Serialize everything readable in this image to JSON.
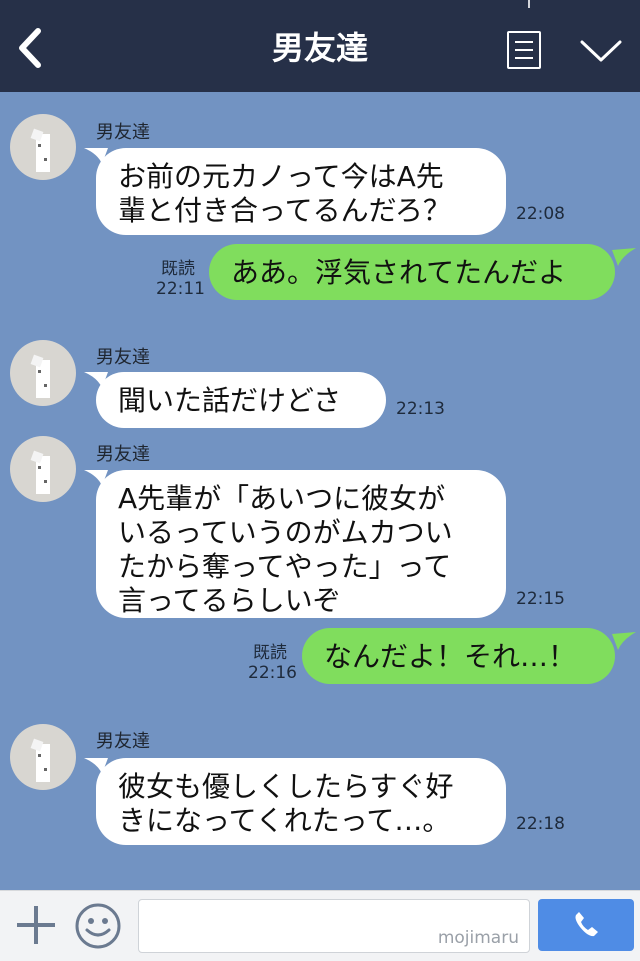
{
  "header": {
    "title": "男友達"
  },
  "messages": [
    {
      "sender": "男友達",
      "text": "お前の元カノって今はA先\n輩と付き合ってるんだろ？",
      "time": "22:08"
    },
    {
      "sender": "me",
      "read": "既読",
      "time": "22:11",
      "text": "ああ。浮気されてたんだよ"
    },
    {
      "sender": "男友達",
      "text": "聞いた話だけどさ",
      "time": "22:13"
    },
    {
      "sender": "男友達",
      "text": "A先輩が「あいつに彼女が\nいるっていうのがムカつい\nたから奪ってやった」って\n言ってるらしいぞ",
      "time": "22:15"
    },
    {
      "sender": "me",
      "read": "既読",
      "time": "22:16",
      "text": "なんだよ！それ…！"
    },
    {
      "sender": "男友達",
      "text": "彼女も優しくしたらすぐ好\nきになってくれたって…。",
      "time": "22:18"
    }
  ],
  "footer": {
    "watermark": "mojimaru"
  },
  "colors": {
    "header": "#263048",
    "background": "#7293c2",
    "my_bubble": "#80dd5d",
    "their_bubble": "#ffffff",
    "call_button": "#4f8ce5"
  },
  "icons": {
    "back": "chevron-left-icon",
    "menu": "menu-icon",
    "collapse": "chevron-down-icon",
    "add": "plus-icon",
    "sticker": "smile-icon",
    "call": "phone-icon"
  }
}
